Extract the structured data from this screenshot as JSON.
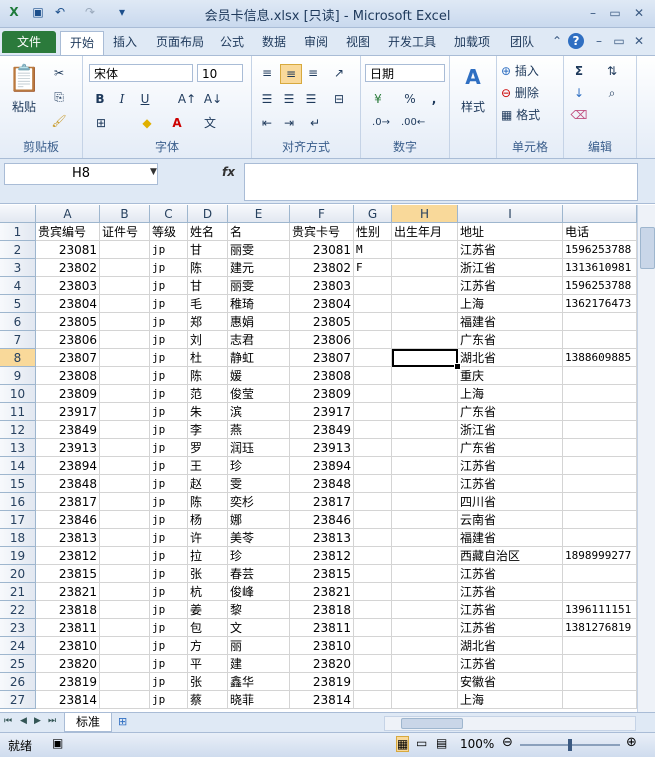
{
  "window": {
    "title": "会员卡信息.xlsx [只读] - Microsoft Excel"
  },
  "ribbon_tabs": [
    "文件",
    "开始",
    "插入",
    "页面布局",
    "公式",
    "数据",
    "审阅",
    "视图",
    "开发工具",
    "加载项",
    "团队"
  ],
  "ribbon": {
    "paste": "粘贴",
    "font_name": "宋体",
    "font_size": "10",
    "number_format": "日期",
    "styles": "样式",
    "insert": "插入",
    "delete": "删除",
    "format": "格式",
    "groups": [
      "剪贴板",
      "字体",
      "对齐方式",
      "数字",
      "单元格",
      "编辑"
    ]
  },
  "formula_bar": {
    "name_box": "H8",
    "fx": "fx",
    "content": ""
  },
  "columns": [
    "A",
    "B",
    "C",
    "D",
    "E",
    "F",
    "G",
    "H",
    "I"
  ],
  "headers": [
    "贵宾编号",
    "证件号",
    "等级",
    "姓名",
    "名",
    "贵宾卡号",
    "性别",
    "出生年月",
    "地址",
    "电话"
  ],
  "rows": [
    [
      "23081",
      "",
      "jp",
      "甘",
      "丽雯",
      "23081",
      "M",
      "",
      "江苏省",
      "1596253788"
    ],
    [
      "23802",
      "",
      "jp",
      "陈",
      "建元",
      "23802",
      "F",
      "",
      "浙江省",
      "1313610981"
    ],
    [
      "23803",
      "",
      "jp",
      "甘",
      "丽雯",
      "23803",
      "",
      "",
      "江苏省",
      "1596253788"
    ],
    [
      "23804",
      "",
      "jp",
      "毛",
      "稚琦",
      "23804",
      "",
      "",
      "上海",
      "1362176473"
    ],
    [
      "23805",
      "",
      "jp",
      "郑",
      "惠娟",
      "23805",
      "",
      "",
      "福建省",
      ""
    ],
    [
      "23806",
      "",
      "jp",
      "刘",
      "志君",
      "23806",
      "",
      "",
      "广东省",
      ""
    ],
    [
      "23807",
      "",
      "jp",
      "杜",
      "静虹",
      "23807",
      "",
      "",
      "湖北省",
      "1388609885"
    ],
    [
      "23808",
      "",
      "jp",
      "陈",
      "媛",
      "23808",
      "",
      "",
      "重庆",
      ""
    ],
    [
      "23809",
      "",
      "jp",
      "范",
      "俊莹",
      "23809",
      "",
      "",
      "上海",
      ""
    ],
    [
      "23917",
      "",
      "jp",
      "朱",
      "滨",
      "23917",
      "",
      "",
      "广东省",
      ""
    ],
    [
      "23849",
      "",
      "jp",
      "李",
      "燕",
      "23849",
      "",
      "",
      "浙江省",
      ""
    ],
    [
      "23913",
      "",
      "jp",
      "罗",
      "润珏",
      "23913",
      "",
      "",
      "广东省",
      ""
    ],
    [
      "23894",
      "",
      "jp",
      "王",
      "珍",
      "23894",
      "",
      "",
      "江苏省",
      ""
    ],
    [
      "23848",
      "",
      "jp",
      "赵",
      "雯",
      "23848",
      "",
      "",
      "江苏省",
      ""
    ],
    [
      "23817",
      "",
      "jp",
      "陈",
      "奕杉",
      "23817",
      "",
      "",
      "四川省",
      ""
    ],
    [
      "23846",
      "",
      "jp",
      "杨",
      "娜",
      "23846",
      "",
      "",
      "云南省",
      ""
    ],
    [
      "23813",
      "",
      "jp",
      "许",
      "美苓",
      "23813",
      "",
      "",
      "福建省",
      ""
    ],
    [
      "23812",
      "",
      "jp",
      "拉",
      "珍",
      "23812",
      "",
      "",
      "西藏自治区",
      "1898999277"
    ],
    [
      "23815",
      "",
      "jp",
      "张",
      "春芸",
      "23815",
      "",
      "",
      "江苏省",
      ""
    ],
    [
      "23821",
      "",
      "jp",
      "杭",
      "俊峰",
      "23821",
      "",
      "",
      "江苏省",
      ""
    ],
    [
      "23818",
      "",
      "jp",
      "姜",
      "黎",
      "23818",
      "",
      "",
      "江苏省",
      "1396111151"
    ],
    [
      "23811",
      "",
      "jp",
      "包",
      "文",
      "23811",
      "",
      "",
      "江苏省",
      "1381276819"
    ],
    [
      "23810",
      "",
      "jp",
      "方",
      "丽",
      "23810",
      "",
      "",
      "湖北省",
      ""
    ],
    [
      "23820",
      "",
      "jp",
      "平",
      "建",
      "23820",
      "",
      "",
      "江苏省",
      ""
    ],
    [
      "23819",
      "",
      "jp",
      "张",
      "鑫华",
      "23819",
      "",
      "",
      "安徽省",
      ""
    ],
    [
      "23814",
      "",
      "jp",
      "蔡",
      "晓菲",
      "23814",
      "",
      "",
      "上海",
      ""
    ]
  ],
  "sheet_tab": "标准",
  "status": {
    "ready": "就绪",
    "zoom": "100%"
  }
}
